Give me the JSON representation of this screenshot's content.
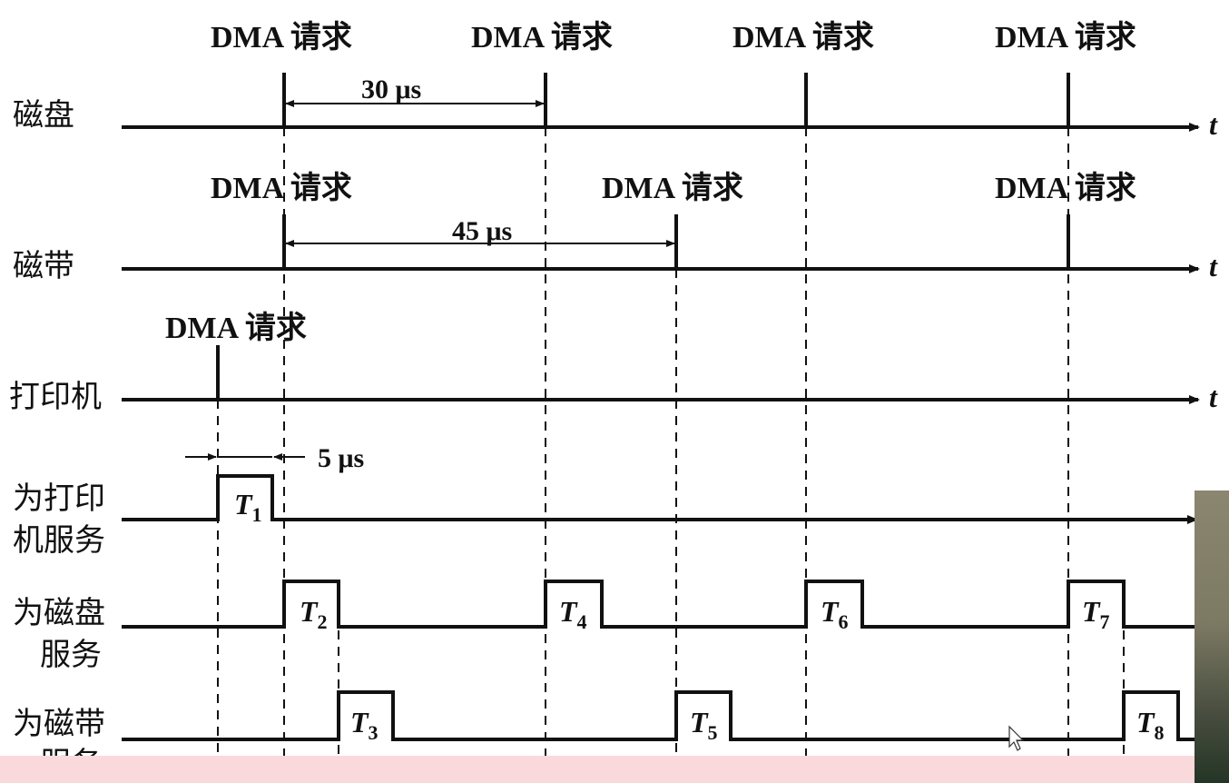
{
  "rows": [
    {
      "label": "磁盘",
      "time_label": "t",
      "requests": [
        "DMA 请求",
        "DMA 请求",
        "DMA 请求",
        "DMA 请求"
      ],
      "interval": "30 μs"
    },
    {
      "label": "磁带",
      "time_label": "t",
      "requests": [
        "DMA 请求",
        "DMA 请求",
        "DMA 请求"
      ],
      "interval": "45 μs"
    },
    {
      "label": "打印机",
      "time_label": "t",
      "requests": [
        "DMA 请求"
      ]
    }
  ],
  "service_rows": [
    {
      "label_line1": "为打印",
      "label_line2": "机服务",
      "slots": [
        {
          "letter": "T",
          "sub": "1"
        }
      ],
      "duration": "5 μs"
    },
    {
      "label_line1": "为磁盘",
      "label_line2": "服务",
      "slots": [
        {
          "letter": "T",
          "sub": "2"
        },
        {
          "letter": "T",
          "sub": "4"
        },
        {
          "letter": "T",
          "sub": "6"
        },
        {
          "letter": "T",
          "sub": "7"
        }
      ]
    },
    {
      "label_line1": "为磁带",
      "label_line2": "服务",
      "slots": [
        {
          "letter": "T",
          "sub": "3"
        },
        {
          "letter": "T",
          "sub": "5"
        },
        {
          "letter": "T",
          "sub": "8"
        }
      ]
    }
  ],
  "dma_parts": {
    "en": "DMA",
    "zh": "请求"
  },
  "unit": "μs",
  "colors": {
    "line": "#111111",
    "background": "#ffffff",
    "bottom_band": "#f9d9dc"
  }
}
